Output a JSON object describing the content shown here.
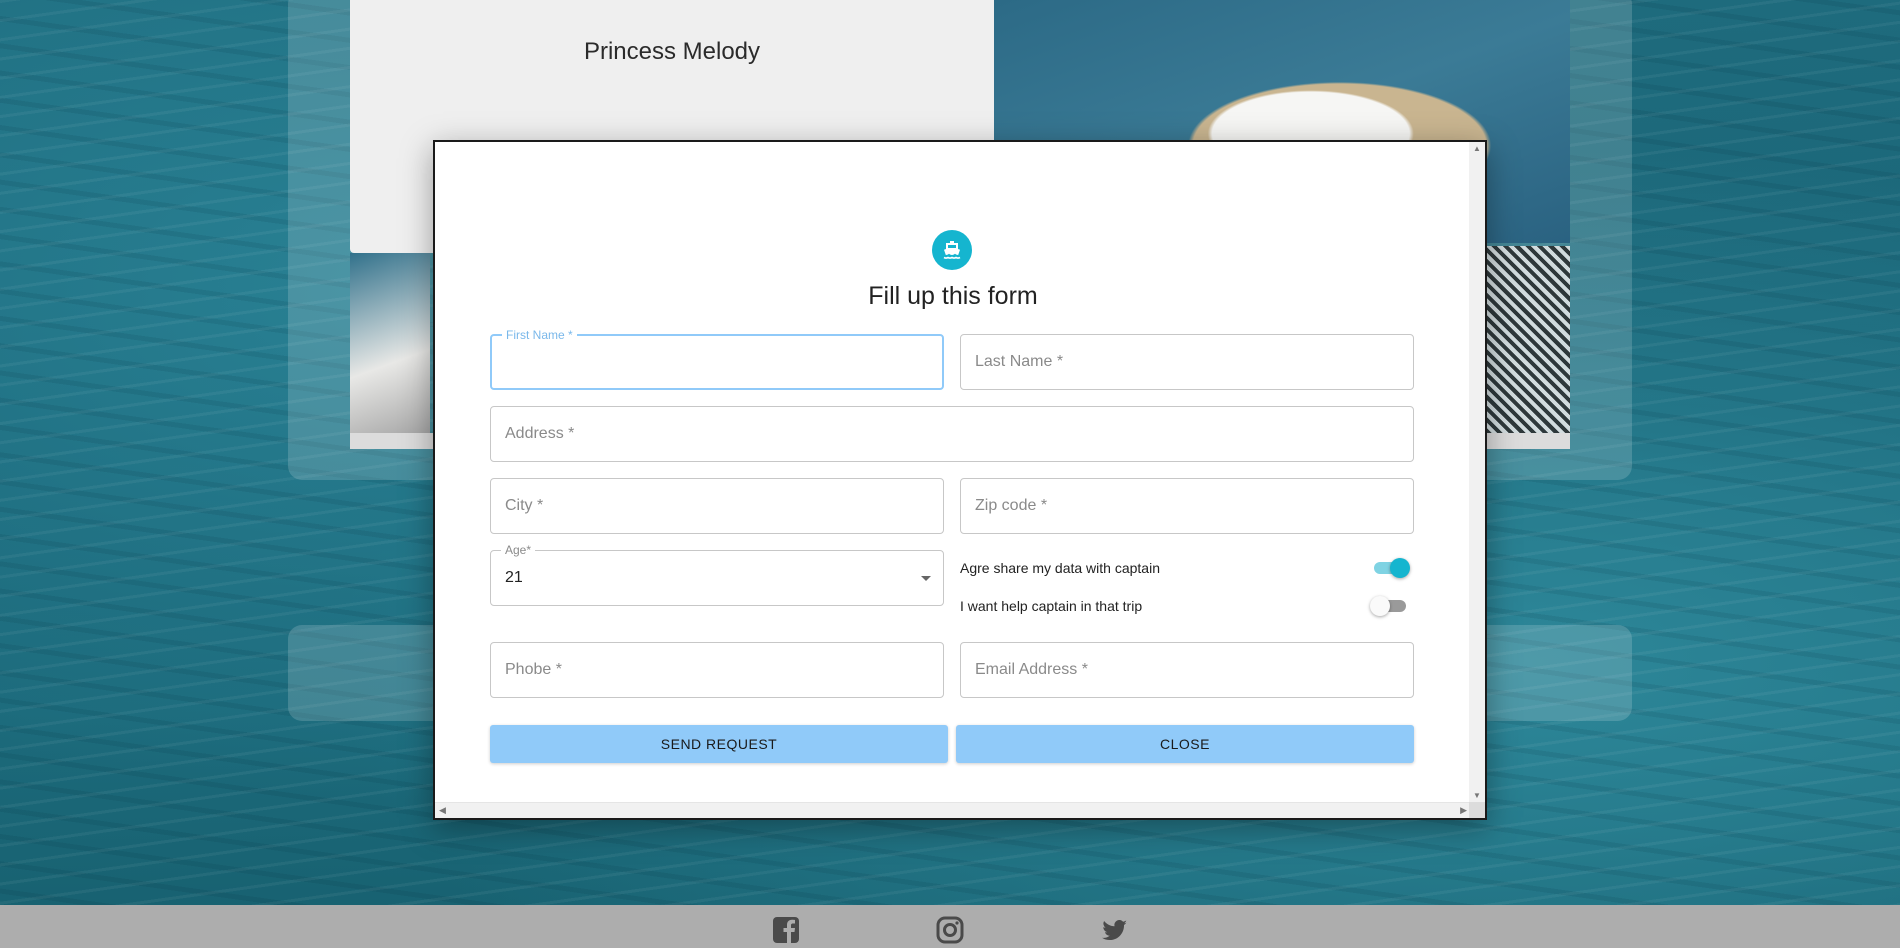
{
  "background": {
    "boat_name": "Princess Melody"
  },
  "footer": {
    "icons": [
      "facebook-icon",
      "instagram-icon",
      "twitter-icon"
    ]
  },
  "modal": {
    "icon": "ship-icon",
    "title": "Fill up this form",
    "fields": {
      "first_name": {
        "label": "First Name *",
        "value": ""
      },
      "last_name": {
        "placeholder": "Last Name *"
      },
      "address": {
        "placeholder": "Address *"
      },
      "city": {
        "placeholder": "City *"
      },
      "zip": {
        "placeholder": "Zip code *"
      },
      "age": {
        "label": "Age*",
        "value": "21"
      },
      "phone": {
        "placeholder": "Phobe *"
      },
      "email": {
        "placeholder": "Email Address *"
      }
    },
    "toggles": {
      "share_data": {
        "label": "Agre share my data with captain",
        "checked": true
      },
      "help_captain": {
        "label": "I want help captain in that trip",
        "checked": false
      }
    },
    "buttons": {
      "send": "SEND REQUEST",
      "close": "CLOSE"
    }
  },
  "colors": {
    "accent": "#15b5cf",
    "button": "#90caf9",
    "focus": "#90caf9"
  }
}
